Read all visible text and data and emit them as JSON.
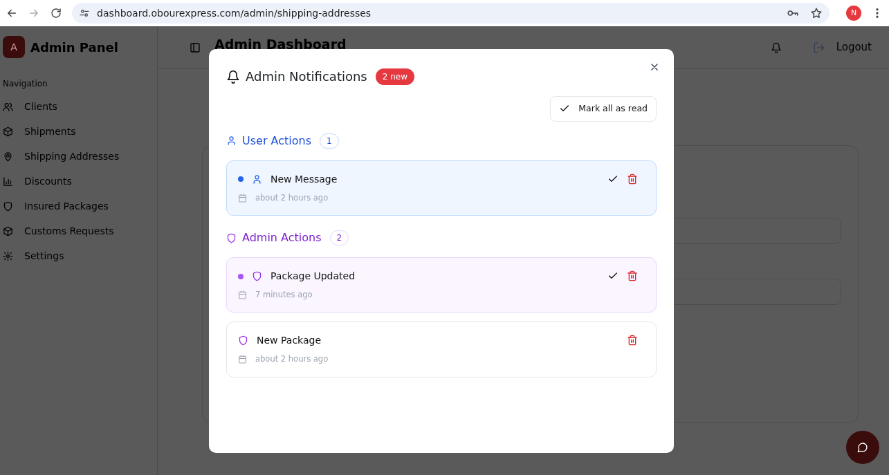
{
  "browser": {
    "url": "dashboard.obourexpress.com/admin/shipping-addresses",
    "profile_initial": "N"
  },
  "sidebar": {
    "logo_letter": "A",
    "title": "Admin Panel",
    "section": "Navigation",
    "items": [
      {
        "label": "Clients"
      },
      {
        "label": "Shipments"
      },
      {
        "label": "Shipping Addresses"
      },
      {
        "label": "Discounts"
      },
      {
        "label": "Insured Packages"
      },
      {
        "label": "Customs Requests"
      },
      {
        "label": "Settings"
      }
    ]
  },
  "header": {
    "title": "Admin Dashboard",
    "logout": "Logout"
  },
  "modal": {
    "title": "Admin Notifications",
    "new_badge": "2 new",
    "mark_all": "Mark all as read",
    "groups": [
      {
        "kind": "user",
        "title": "User Actions",
        "count": "1",
        "items": [
          {
            "title": "New Message",
            "time": "about 2 hours ago",
            "unread": true
          }
        ]
      },
      {
        "kind": "admin",
        "title": "Admin Actions",
        "count": "2",
        "items": [
          {
            "title": "Package Updated",
            "time": "7 minutes ago",
            "unread": true
          },
          {
            "title": "New Package",
            "time": "about 2 hours ago",
            "unread": false
          }
        ]
      }
    ]
  }
}
